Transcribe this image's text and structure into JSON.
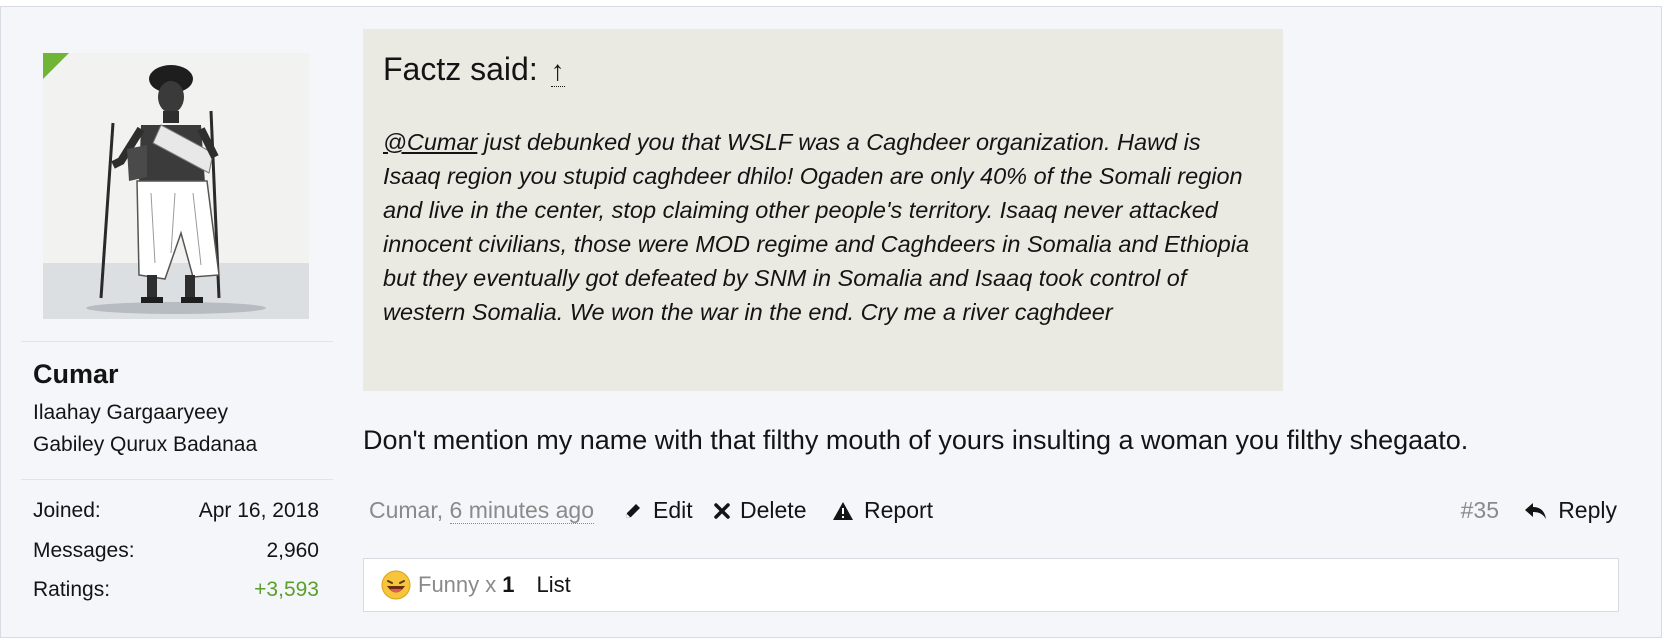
{
  "user": {
    "name": "Cumar",
    "title_line1": "Ilaahay Gargaaryeey",
    "title_line2": "Gabiley Qurux Badanaa",
    "stats": [
      {
        "label": "Joined:",
        "value": "Apr 16, 2018"
      },
      {
        "label": "Messages:",
        "value": "2,960"
      },
      {
        "label": "Ratings:",
        "value": "+3,593"
      }
    ],
    "online_indicator_color": "#70b536",
    "avatar_icon": "avatar-portrait-illustration"
  },
  "quote": {
    "author_line": "Factz said:",
    "arrow": "↑",
    "mention": "@Cumar",
    "body": " just debunked you that WSLF was a Caghdeer organization. Hawd is Isaaq region you stupid caghdeer dhilo! Ogaden are only 40% of the Somali region and live in the center, stop claiming other people's territory. Isaaq never attacked innocent civilians, those were MOD regime and Caghdeers in Somalia and Ethiopia but they eventually got defeated by SNM in Somalia and Isaaq took control of western Somalia. We won the war in the end. Cry me a river caghdeer"
  },
  "message": {
    "text": "Don't mention my name with that filthy mouth of yours insulting a woman you filthy shegaato."
  },
  "footer": {
    "author": "Cumar",
    "separator": ", ",
    "time": "6 minutes ago",
    "edit_label": "Edit",
    "delete_label": "Delete",
    "report_label": "Report",
    "post_number": "#35",
    "reply_label": "Reply"
  },
  "reactions": {
    "emoji_icon": "laughing-emoji-icon",
    "label": "Funny x",
    "count": "1",
    "list_label": "List"
  }
}
